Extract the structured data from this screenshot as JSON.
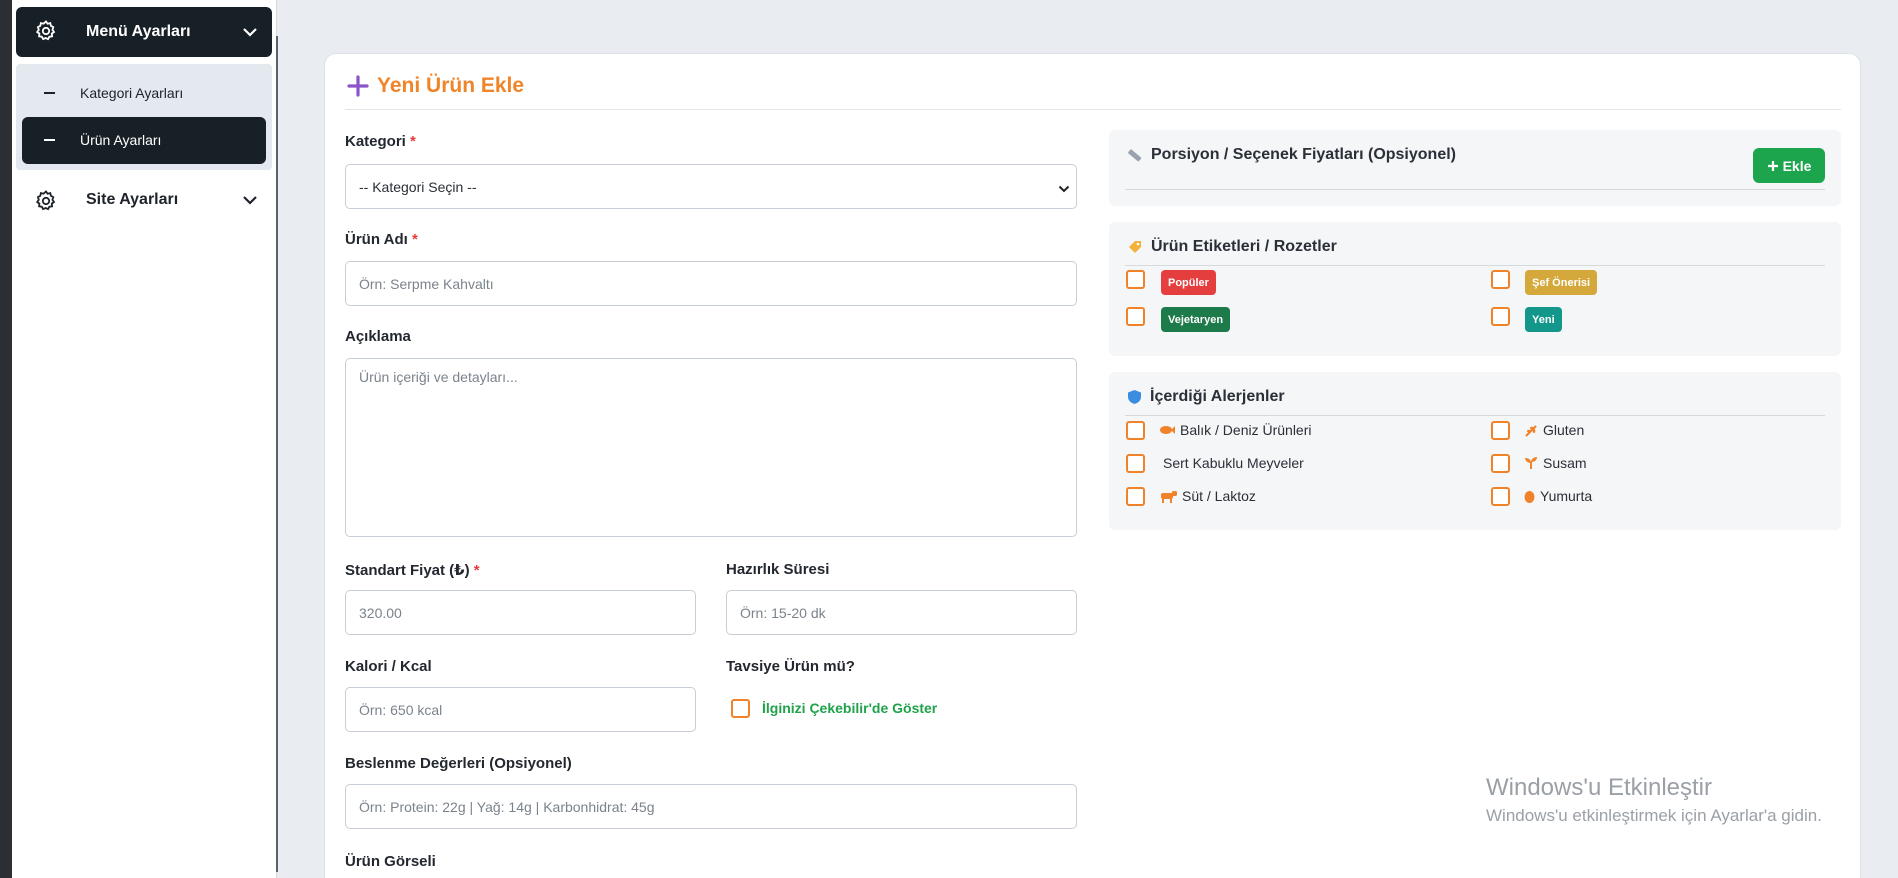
{
  "sidebar": {
    "menu_settings": "Menü Ayarları",
    "category_settings": "Kategori Ayarları",
    "product_settings": "Ürün Ayarları",
    "site_settings": "Site Ayarları"
  },
  "form": {
    "title": "Yeni Ürün Ekle",
    "category": {
      "label": "Kategori",
      "required": "*",
      "value": "-- Kategori Seçin --"
    },
    "product_name": {
      "label": "Ürün Adı",
      "required": "*",
      "placeholder": "Örn: Serpme Kahvaltı"
    },
    "description": {
      "label": "Açıklama",
      "placeholder": "Ürün içeriği ve detayları..."
    },
    "price": {
      "label": "Standart Fiyat (₺)",
      "required": "*",
      "value": "320.00"
    },
    "prep_time": {
      "label": "Hazırlık Süresi",
      "placeholder": "Örn: 15-20 dk"
    },
    "calories": {
      "label": "Kalori / Kcal",
      "placeholder": "Örn: 650 kcal"
    },
    "recommended": {
      "label": "Tavsiye Ürün mü?",
      "checkbox_label": "İlginizi Çekebilir'de Göster"
    },
    "nutrition": {
      "label": "Beslenme Değerleri (Opsiyonel)",
      "placeholder": "Örn: Protein: 22g | Yağ: 14g | Karbonhidrat: 45g"
    },
    "image": {
      "label": "Ürün Görseli"
    }
  },
  "portions": {
    "title": "Porsiyon / Seçenek Fiyatları (Opsiyonel)",
    "add_button": "Ekle"
  },
  "tags": {
    "title": "Ürün Etiketleri / Rozetler",
    "items": [
      {
        "label": "Popüler",
        "color": "#e53e3e"
      },
      {
        "label": "Şef Önerisi",
        "color": "#d4a83a"
      },
      {
        "label": "Vejetaryen",
        "color": "#1d7a4a"
      },
      {
        "label": "Yeni",
        "color": "#12978a"
      }
    ]
  },
  "allergens": {
    "title": "İçerdiği Alerjenler",
    "items": [
      {
        "label": "Balık / Deniz Ürünleri",
        "icon": "fish-icon"
      },
      {
        "label": "Gluten",
        "icon": "wheat-icon"
      },
      {
        "label": "Sert Kabuklu Meyveler",
        "icon": ""
      },
      {
        "label": "Susam",
        "icon": "seedling-icon"
      },
      {
        "label": "Süt / Laktoz",
        "icon": "cow-icon"
      },
      {
        "label": "Yumurta",
        "icon": "egg-icon"
      }
    ]
  },
  "watermark": {
    "line1": "Windows'u Etkinleştir",
    "line2": "Windows'u etkinleştirmek için Ayarlar'a gidin."
  },
  "colors": {
    "accent_orange": "#f08428",
    "dark": "#172026",
    "success": "#1da54e"
  }
}
